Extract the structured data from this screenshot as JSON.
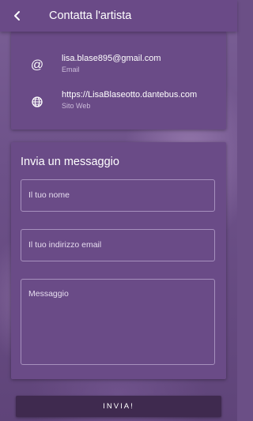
{
  "appbar": {
    "title": "Contatta l'artista",
    "back_icon": "arrow-back-icon"
  },
  "contacts": [
    {
      "value": "lisa.blase895@gmail.com",
      "label": "Email",
      "icon": "at-icon"
    },
    {
      "value": "https://LisaBlaseotto.dantebus.com",
      "label": "Sito Web",
      "icon": "globe-icon"
    }
  ],
  "form": {
    "title": "Invia un messaggio",
    "name_placeholder": "Il tuo nome",
    "email_placeholder": "Il tuo indirizzo email",
    "message_placeholder": "Messaggio",
    "submit_label": "INVIA!"
  },
  "colors": {
    "accent": "#6a4a87",
    "button": "#3f2a4f",
    "text": "#ffffff"
  }
}
